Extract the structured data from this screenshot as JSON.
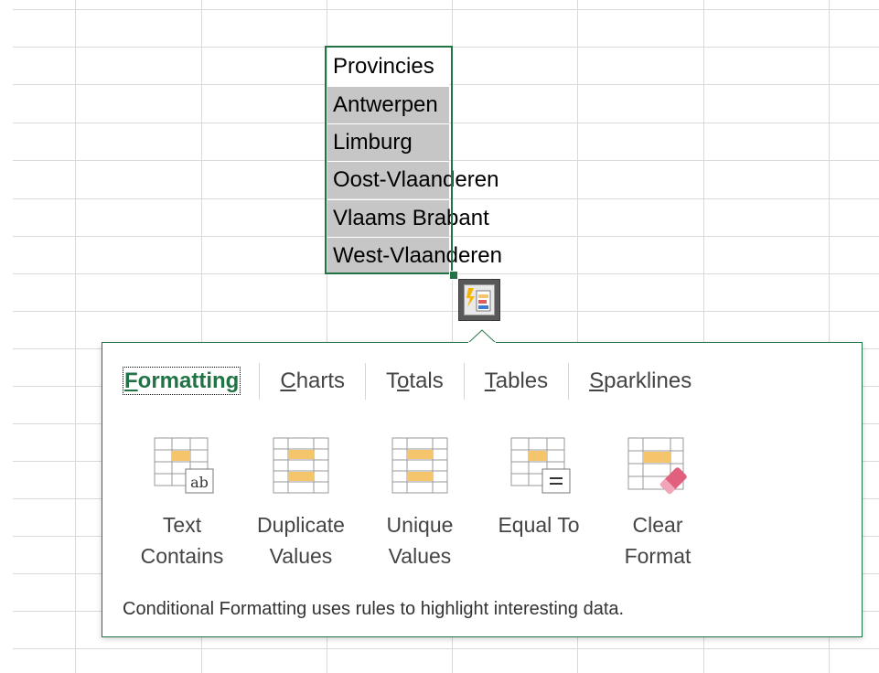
{
  "cells": {
    "header": "Provincies",
    "rows": [
      "Antwerpen",
      "Limburg",
      "Oost-Vlaanderen",
      "Vlaams Brabant",
      "West-Vlaanderen"
    ]
  },
  "quick_analysis_button": {
    "icon": "quick-analysis-icon"
  },
  "panel": {
    "tabs": [
      {
        "label": "Formatting",
        "access_key": "F",
        "active": true
      },
      {
        "label": "Charts",
        "access_key": "C",
        "active": false
      },
      {
        "label": "Totals",
        "access_key": "o",
        "active": false
      },
      {
        "label": "Tables",
        "access_key": "T",
        "active": false
      },
      {
        "label": "Sparklines",
        "access_key": "S",
        "active": false
      }
    ],
    "tools": [
      {
        "line1": "Text",
        "line2": "Contains",
        "icon": "text-contains-icon"
      },
      {
        "line1": "Duplicate",
        "line2": "Values",
        "icon": "duplicate-values-icon"
      },
      {
        "line1": "Unique",
        "line2": "Values",
        "icon": "unique-values-icon"
      },
      {
        "line1": "Equal To",
        "line2": "",
        "icon": "equal-to-icon"
      },
      {
        "line1": "Clear",
        "line2": "Format",
        "icon": "clear-format-icon"
      }
    ],
    "footer": "Conditional Formatting uses rules to highlight interesting data."
  },
  "colors": {
    "accent": "#217346",
    "selection_fill": "#c6c6c6",
    "highlight_bar": "#f4c56a",
    "eraser": "#e0607e"
  }
}
